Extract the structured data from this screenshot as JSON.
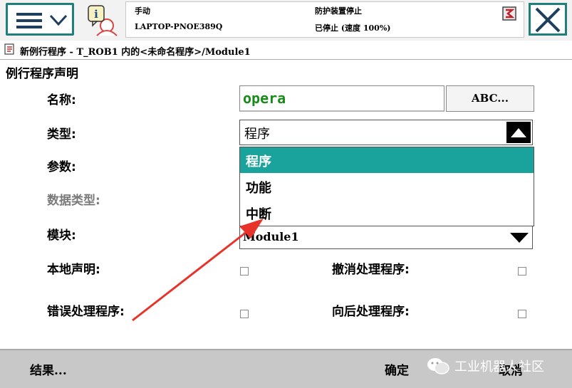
{
  "header": {
    "mode": "手动",
    "host": "LAPTOP-PNOE389Q",
    "safety": "防护装置停止",
    "state": "已停止 (速度 100%)"
  },
  "breadcrumb": "新例行程序 - T_ROB1 内的<未命名程序>/Module1",
  "form": {
    "section_title": "例行程序声明",
    "name_label": "名称:",
    "name_value": "opera",
    "abc_button": "ABC...",
    "type_label": "类型:",
    "type_value": "程序",
    "type_options": [
      "程序",
      "功能",
      "中断"
    ],
    "params_label": "参数:",
    "datatype_label": "数据类型:",
    "module_label": "模块:",
    "module_value": "Module1",
    "local_label": "本地声明:",
    "undo_label": "撤消处理程序:",
    "error_label": "错误处理程序:",
    "backward_label": "向后处理程序:"
  },
  "footer": {
    "results": "结果...",
    "ok": "确定",
    "cancel": "取消",
    "watermark": "工业机器人社区"
  },
  "colors": {
    "accent_teal": "#1aa39c",
    "border_teal": "#1f7f7c",
    "annotation_red": "#e8332a",
    "name_green": "#1a8a1a"
  }
}
